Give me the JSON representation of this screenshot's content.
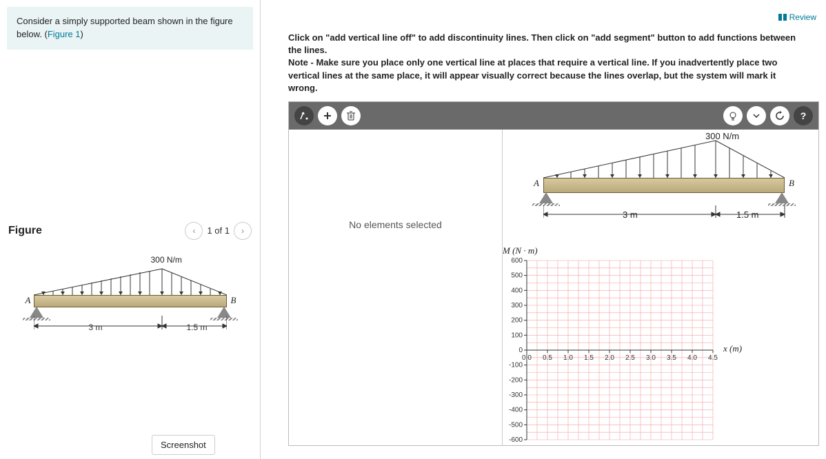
{
  "left": {
    "prompt_prefix": "Consider a simply supported beam shown in the figure below. (",
    "prompt_link": "Figure 1",
    "prompt_suffix": ")",
    "figure_heading": "Figure",
    "pager_text": "1 of 1",
    "screenshot_label": "Screenshot"
  },
  "top": {
    "review_label": "Review"
  },
  "instructions": {
    "line1": "Click on \"add vertical line off\" to add discontinuity lines. Then click on \"add segment\" button to add functions between the lines.",
    "line2": "Note - Make sure you place only one vertical line at places that require a vertical line. If you inadvertently place two vertical lines at the same place, it will appear visually correct because the lines overlap, but the system will mark it wrong."
  },
  "editor": {
    "no_selection": "No elements selected"
  },
  "beam": {
    "load_label": "300 N/m",
    "point_A": "A",
    "point_B": "B",
    "dim1": "3 m",
    "dim2": "1.5 m"
  },
  "chart_data": {
    "type": "line",
    "title": "",
    "ylabel": "M (N · m)",
    "xlabel": "x (m)",
    "xlim": [
      0,
      4.5
    ],
    "ylim": [
      -600,
      600
    ],
    "x_ticks": [
      "0.0",
      "0.5",
      "1.0",
      "1.5",
      "2.0",
      "2.5",
      "3.0",
      "3.5",
      "4.0",
      "4.5"
    ],
    "y_ticks": [
      "600",
      "500",
      "400",
      "300",
      "200",
      "100",
      "0",
      "-100",
      "-200",
      "-300",
      "-400",
      "-500",
      "-600"
    ],
    "series": []
  }
}
